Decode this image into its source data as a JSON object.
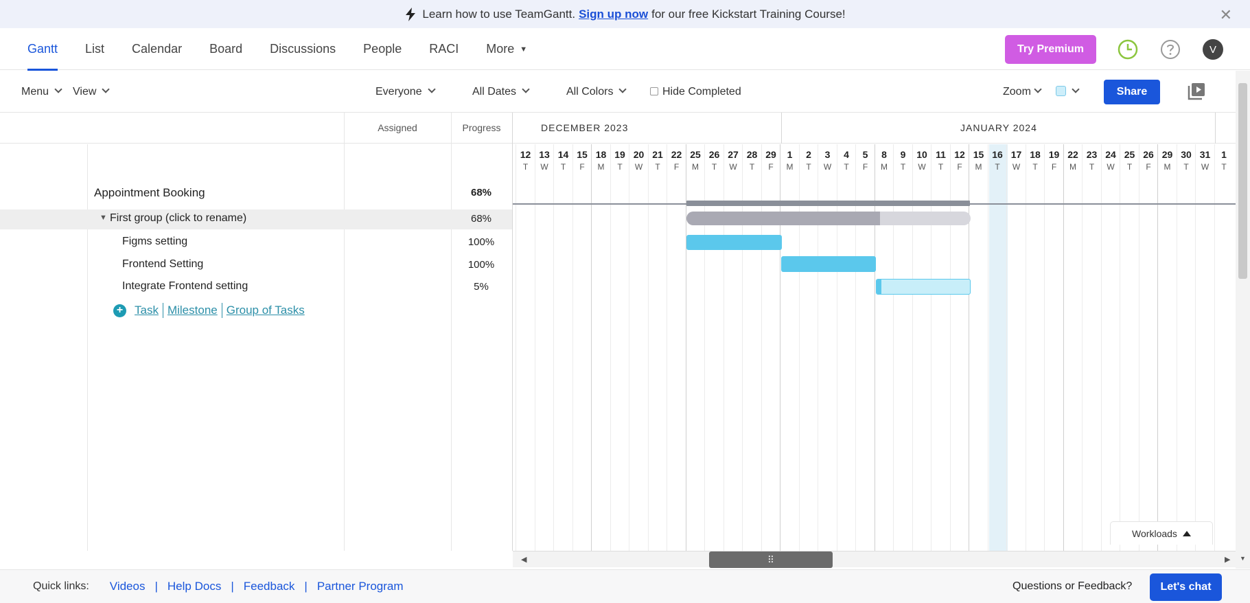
{
  "banner": {
    "text_before": "Learn how to use TeamGantt.",
    "link": "Sign up now",
    "text_after": "for our free Kickstart Training Course!",
    "close": "✕"
  },
  "nav": {
    "tabs": [
      "Gantt",
      "List",
      "Calendar",
      "Board",
      "Discussions",
      "People",
      "RACI",
      "More"
    ],
    "active_tab": "Gantt",
    "more_caret": "▼",
    "premium": "Try Premium",
    "avatar_initial": "V"
  },
  "toolbar": {
    "menu": "Menu",
    "view": "View",
    "everyone": "Everyone",
    "all_dates": "All Dates",
    "all_colors": "All Colors",
    "hide_completed": "Hide Completed",
    "zoom": "Zoom",
    "share": "Share"
  },
  "columns": {
    "assigned": "Assigned",
    "progress": "Progress"
  },
  "months": [
    "DECEMBER 2023",
    "JANUARY 2024"
  ],
  "days": [
    {
      "d": "12",
      "w": "T"
    },
    {
      "d": "13",
      "w": "W"
    },
    {
      "d": "14",
      "w": "T"
    },
    {
      "d": "15",
      "w": "F"
    },
    {
      "d": "18",
      "w": "M"
    },
    {
      "d": "19",
      "w": "T"
    },
    {
      "d": "20",
      "w": "W"
    },
    {
      "d": "21",
      "w": "T"
    },
    {
      "d": "22",
      "w": "F"
    },
    {
      "d": "25",
      "w": "M"
    },
    {
      "d": "26",
      "w": "T"
    },
    {
      "d": "27",
      "w": "W"
    },
    {
      "d": "28",
      "w": "T"
    },
    {
      "d": "29",
      "w": "F"
    },
    {
      "d": "1",
      "w": "M"
    },
    {
      "d": "2",
      "w": "T"
    },
    {
      "d": "3",
      "w": "W"
    },
    {
      "d": "4",
      "w": "T"
    },
    {
      "d": "5",
      "w": "F"
    },
    {
      "d": "8",
      "w": "M"
    },
    {
      "d": "9",
      "w": "T"
    },
    {
      "d": "10",
      "w": "W"
    },
    {
      "d": "11",
      "w": "T"
    },
    {
      "d": "12",
      "w": "F"
    },
    {
      "d": "15",
      "w": "M"
    },
    {
      "d": "16",
      "w": "T"
    },
    {
      "d": "17",
      "w": "W"
    },
    {
      "d": "18",
      "w": "T"
    },
    {
      "d": "19",
      "w": "F"
    },
    {
      "d": "22",
      "w": "M"
    },
    {
      "d": "23",
      "w": "T"
    },
    {
      "d": "24",
      "w": "W"
    },
    {
      "d": "25",
      "w": "T"
    },
    {
      "d": "26",
      "w": "F"
    },
    {
      "d": "29",
      "w": "M"
    },
    {
      "d": "30",
      "w": "T"
    },
    {
      "d": "31",
      "w": "W"
    },
    {
      "d": "1",
      "w": "T"
    }
  ],
  "today_label": "16",
  "project": {
    "name": "Appointment Booking",
    "progress": "68%"
  },
  "group": {
    "name": "First group (click to rename)",
    "progress": "68%",
    "caret": "▼"
  },
  "tasks": [
    {
      "name": "Figms setting",
      "progress": "100%"
    },
    {
      "name": "Frontend Setting",
      "progress": "100%"
    },
    {
      "name": "Integrate Frontend setting",
      "progress": "5%"
    }
  ],
  "add_links": {
    "plus": "+",
    "task": "Task",
    "milestone": "Milestone",
    "group": "Group of Tasks"
  },
  "workloads": "Workloads",
  "scroll_grip": "⠿",
  "scroll_left": "◀",
  "scroll_right": "▶",
  "scroll_down": "▼",
  "footer": {
    "quick_links_label": "Quick links:",
    "links": [
      "Videos",
      "Help Docs",
      "Feedback",
      "Partner Program"
    ],
    "pipe": "|",
    "questions": "Questions or Feedback?",
    "chat": "Let's chat"
  },
  "colors": {
    "accent": "#1a56db",
    "premium": "#d05ce3",
    "task_bar": "#5bc8ec",
    "task_bar_light": "#c8eef9",
    "group_bar": "#a9a9b3",
    "group_bar_bg": "#d7d7dd",
    "today_col": "#e3f1f8"
  },
  "icons": [
    "bolt-icon",
    "close-icon",
    "clock-icon",
    "help-icon",
    "media-icon",
    "plus-icon",
    "up-caret-icon"
  ]
}
